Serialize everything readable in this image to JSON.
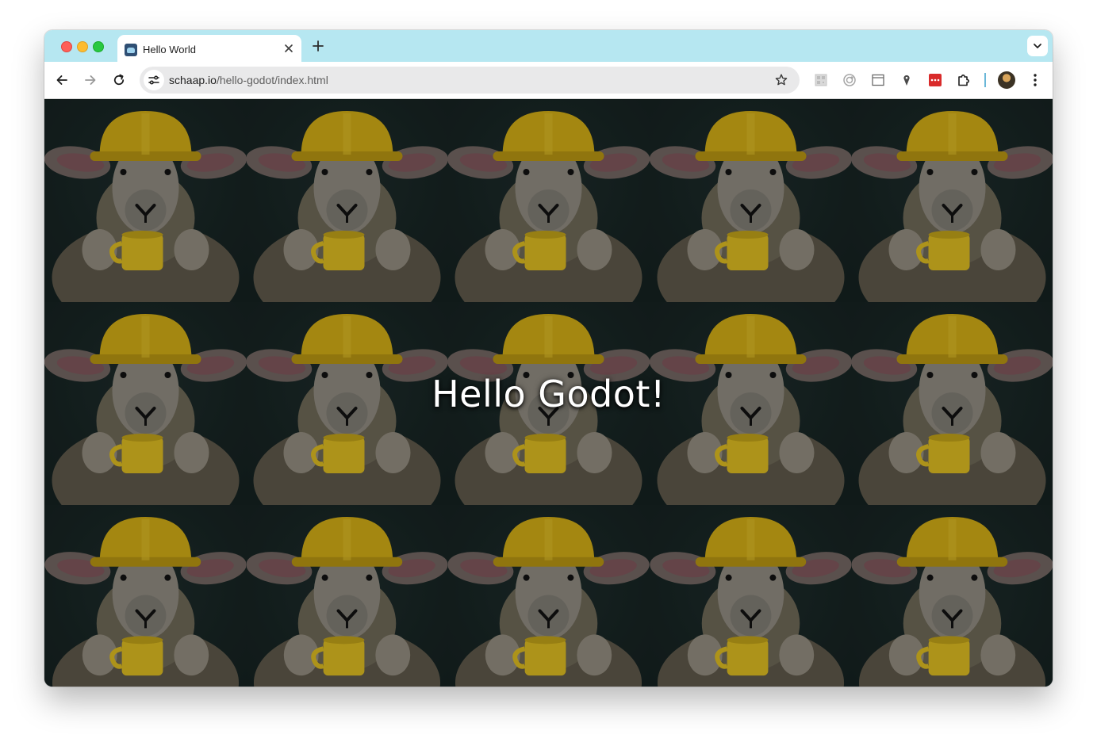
{
  "browser": {
    "tab": {
      "title": "Hello World",
      "favicon_icon": "godot-icon"
    },
    "new_tab_label": "+",
    "address_bar": {
      "host": "schaap.io",
      "path": "/hello-godot/index.html"
    },
    "extensions": [
      "qr-code-icon",
      "ring-icon",
      "window-icon",
      "map-pin-icon",
      "password-manager-icon",
      "puzzle-icon"
    ],
    "colors": {
      "tabstrip": "#b6e7f1",
      "accent_separator": "#6ab7d8",
      "password_manager": "#d92b2b"
    }
  },
  "page": {
    "heading": "Hello Godot!",
    "background_tile": {
      "subject": "sheep-in-hard-hat-with-mug-image",
      "columns": 5,
      "rows": 3,
      "colors": {
        "helmet": "#c9a515",
        "mug": "#d4b420",
        "backdrop": "#14201f"
      }
    }
  }
}
